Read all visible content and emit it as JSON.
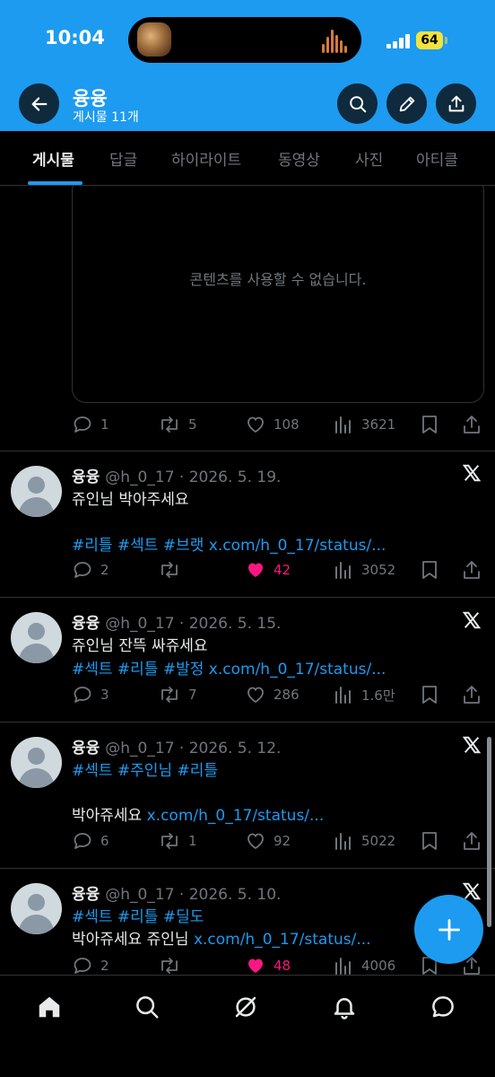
{
  "status_bar": {
    "time": "10:04",
    "battery_level": "64",
    "signal_bars": 4,
    "battery_color": "#f3e33d"
  },
  "header": {
    "name": "융융",
    "post_count": "게시물 11개",
    "background_color": "#1d9bf0",
    "buttons": [
      "back-arrow-icon",
      "search-icon",
      "pencil-icon",
      "share-icon"
    ]
  },
  "tabs": [
    {
      "label": "게시물",
      "active": true
    },
    {
      "label": "답글",
      "active": false
    },
    {
      "label": "하이라이트",
      "active": false
    },
    {
      "label": "동영상",
      "active": false
    },
    {
      "label": "사진",
      "active": false
    },
    {
      "label": "아티클",
      "active": false
    }
  ],
  "unavailable_post": {
    "message": "콘텐츠를 사용할 수 없습니다.",
    "actions": {
      "replies": "1",
      "reposts": "5",
      "likes": "108",
      "views": "3621"
    }
  },
  "posts": [
    {
      "name": "융융",
      "handle": "@h_0_17 · 2026. 5. 19.",
      "text_line_1": "쥬인님 박아주세요",
      "tags": "#리틀 #섹트 #브랫",
      "link": "x.com/h_0_17/status/...",
      "replies": "2",
      "reposts": "",
      "likes": "42",
      "views": "3052",
      "liked": true
    },
    {
      "name": "융융",
      "handle": "@h_0_17 · 2026. 5. 15.",
      "text_line_1": "쥬인님 잔뜩 싸쥬세요",
      "tags": "#섹트 #리틀 #발정",
      "link": "x.com/h_0_17/status/...",
      "replies": "3",
      "reposts": "7",
      "likes": "286",
      "views": "1.6만",
      "liked": false
    },
    {
      "name": "융융",
      "handle": "@h_0_17 · 2026. 5. 12.",
      "tags": "#섹트 #주인님 #리틀",
      "text_line_2": "박아쥬세요",
      "link": "x.com/h_0_17/status/...",
      "replies": "6",
      "reposts": "1",
      "likes": "92",
      "views": "5022",
      "liked": false
    },
    {
      "name": "융융",
      "handle": "@h_0_17 · 2026. 5. 10.",
      "tags": "#섹트 #리틀 #딜도",
      "text_line_2": "박아쥬세요 쥬인님",
      "link": "x.com/h_0_17/status/...",
      "replies": "2",
      "reposts": "",
      "likes": "48",
      "views": "4006",
      "liked": true
    }
  ],
  "fab_icon": "plus-icon",
  "bottom_nav": [
    "home-icon",
    "search-icon",
    "grok-icon",
    "bell-icon",
    "messages-icon"
  ],
  "colors": {
    "accent": "#1d9bf0",
    "like": "#f91880",
    "muted": "#71767b",
    "text": "#e7e9ea",
    "background": "#000000"
  }
}
